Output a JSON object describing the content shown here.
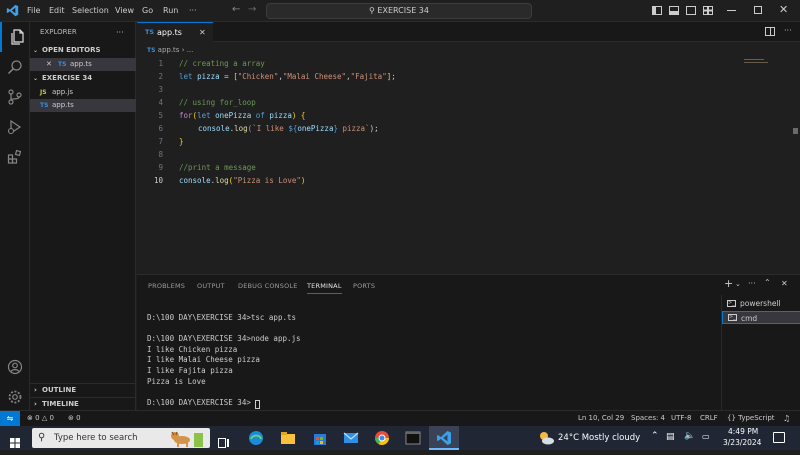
{
  "titlebar": {
    "menu": [
      "File",
      "Edit",
      "Selection",
      "View",
      "Go",
      "Run",
      "···"
    ],
    "search": "EXERCISE 34"
  },
  "sidebar": {
    "explorer_title": "EXPLORER",
    "more": "···",
    "open_editors": "OPEN EDITORS",
    "open_file": "app.ts",
    "project": "EXERCISE 34",
    "files": [
      {
        "badge": "JS",
        "name": "app.js"
      },
      {
        "badge": "TS",
        "name": "app.ts"
      }
    ],
    "outline": "OUTLINE",
    "timeline": "TIMELINE"
  },
  "editor": {
    "tab_badge": "TS",
    "tab_name": "app.ts",
    "breadcrumb_badge": "TS",
    "breadcrumb_file": "app.ts",
    "breadcrumb_rest": "› ...",
    "line_numbers": [
      "1",
      "2",
      "3",
      "4",
      "5",
      "6",
      "7",
      "8",
      "9",
      "10"
    ],
    "lines": {
      "l1": "// creating a array",
      "l2_kw": "let",
      "l2_var": "pizza",
      "l2_eq": " = ",
      "l2_open": "[",
      "l2_s1": "\"Chicken\"",
      "l2_c1": ",",
      "l2_s2": "\"Malai Cheese\"",
      "l2_c2": ",",
      "l2_s3": "\"Fajita\"",
      "l2_close": "];",
      "l4": "// using for_loop",
      "l5_for": "for",
      "l5_p": "(",
      "l5_let": "let",
      "l5_v1": "onePizza",
      "l5_of": "of",
      "l5_v2": "pizza",
      "l5_end": ") {",
      "l6_obj": "console",
      "l6_dot": ".",
      "l6_fn": "log",
      "l6_p": "(",
      "l6_t1": "`I like ",
      "l6_i1": "${",
      "l6_iv": "onePizza",
      "l6_i2": "}",
      "l6_t2": " pizza`",
      "l6_end": ");",
      "l7": "}",
      "l9": "//print a message",
      "l10_obj": "console",
      "l10_dot": ".",
      "l10_fn": "log",
      "l10_p1": "(",
      "l10_s": "\"Pizza is Love\"",
      "l10_p2": ")"
    }
  },
  "panel": {
    "tabs": [
      "PROBLEMS",
      "OUTPUT",
      "DEBUG CONSOLE",
      "TERMINAL",
      "PORTS"
    ],
    "active_tab": "TERMINAL",
    "terminal_lines": [
      "D:\\100 DAY\\EXERCISE 34>tsc app.ts",
      "",
      "D:\\100 DAY\\EXERCISE 34>node app.js",
      "I like Chicken pizza",
      "I like Malai Cheese pizza",
      "I like Fajita pizza",
      "Pizza is Love",
      "",
      "D:\\100 DAY\\EXERCISE 34>"
    ],
    "terminals": [
      "powershell",
      "cmd"
    ]
  },
  "statusbar": {
    "errors": "0",
    "warnings": "0",
    "ports": "0",
    "position": "Ln 10, Col 29",
    "spaces": "Spaces: 4",
    "encoding": "UTF-8",
    "eol": "CRLF",
    "language": "TypeScript"
  },
  "taskbar": {
    "search_placeholder": "Type here to search",
    "weather": "24°C  Mostly cloudy",
    "time": "4:49 PM",
    "date": "3/23/2024"
  },
  "colors": {
    "accent": "#0078d4",
    "background": "#1f1f1f",
    "statusbar_remote": "#0078d4"
  }
}
